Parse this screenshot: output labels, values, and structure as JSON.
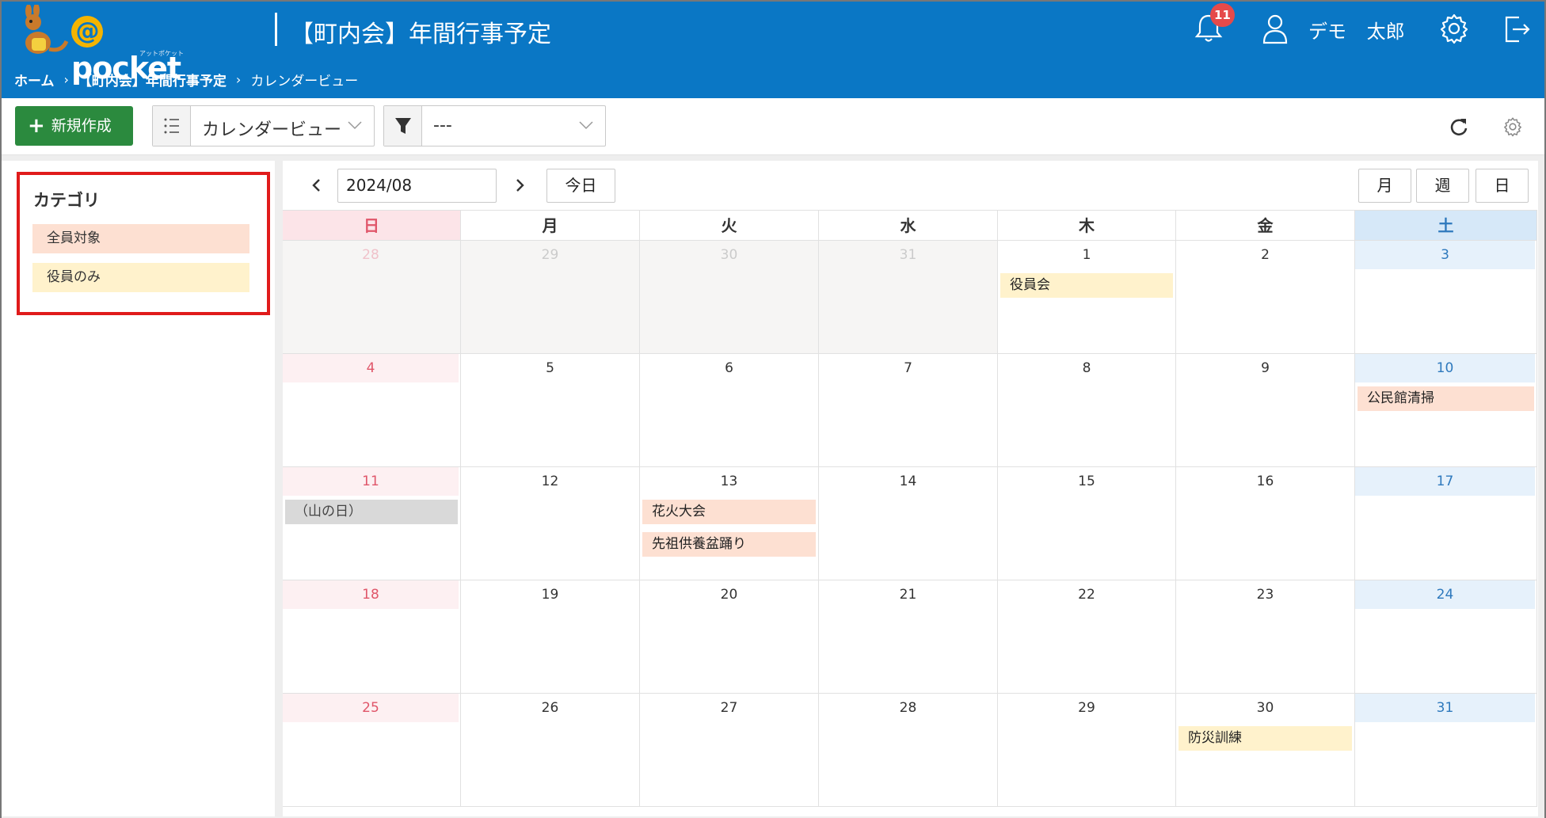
{
  "header": {
    "brand": "pocket",
    "brand_at": "@",
    "brand_sub": "アットポケット",
    "title": "【町内会】年間行事予定",
    "notification_count": "11",
    "user_name": "デモ 太郎",
    "icons": [
      "bell-icon",
      "user-icon",
      "gear-icon",
      "logout-icon"
    ]
  },
  "breadcrumb": {
    "home": "ホーム",
    "app": "【町内会】年間行事予定",
    "current": "カレンダービュー",
    "separator": "›"
  },
  "toolbar": {
    "new_label": "新規作成",
    "view_select": "カレンダービュー",
    "filter_select": "---"
  },
  "sidebar": {
    "category_title": "カテゴリ",
    "categories": [
      {
        "label": "全員対象",
        "color": "#fde0d2"
      },
      {
        "label": "役員のみ",
        "color": "#fff2cc"
      }
    ]
  },
  "calendar": {
    "current_month": "2024/08",
    "today_label": "今日",
    "views": {
      "month": "月",
      "week": "週",
      "day": "日"
    },
    "weekdays": [
      "日",
      "月",
      "火",
      "水",
      "木",
      "金",
      "土"
    ],
    "weeks": [
      [
        {
          "d": "28",
          "other": true
        },
        {
          "d": "29",
          "other": true
        },
        {
          "d": "30",
          "other": true
        },
        {
          "d": "31",
          "other": true
        },
        {
          "d": "1",
          "events": [
            {
              "t": "役員会",
              "k": "officer"
            }
          ]
        },
        {
          "d": "2"
        },
        {
          "d": "3"
        }
      ],
      [
        {
          "d": "4"
        },
        {
          "d": "5"
        },
        {
          "d": "6"
        },
        {
          "d": "7"
        },
        {
          "d": "8"
        },
        {
          "d": "9"
        },
        {
          "d": "10",
          "events": [
            {
              "t": "公民館清掃",
              "k": "all"
            }
          ]
        }
      ],
      [
        {
          "d": "11",
          "events": [
            {
              "t": "（山の日）",
              "k": "holiday"
            }
          ]
        },
        {
          "d": "12"
        },
        {
          "d": "13",
          "events": [
            {
              "t": "花火大会",
              "k": "all"
            },
            {
              "t": "先祖供養盆踊り",
              "k": "all"
            }
          ]
        },
        {
          "d": "14"
        },
        {
          "d": "15"
        },
        {
          "d": "16"
        },
        {
          "d": "17"
        }
      ],
      [
        {
          "d": "18"
        },
        {
          "d": "19"
        },
        {
          "d": "20"
        },
        {
          "d": "21"
        },
        {
          "d": "22"
        },
        {
          "d": "23"
        },
        {
          "d": "24"
        }
      ],
      [
        {
          "d": "25"
        },
        {
          "d": "26"
        },
        {
          "d": "27"
        },
        {
          "d": "28"
        },
        {
          "d": "29"
        },
        {
          "d": "30",
          "events": [
            {
              "t": "防災訓練",
              "k": "officer"
            }
          ]
        },
        {
          "d": "31"
        }
      ]
    ]
  },
  "colors": {
    "header_bg": "#0a77c5",
    "new_button": "#2b8a3e",
    "sunday": "#e0566a",
    "saturday": "#2e79bd",
    "highlight_box": "#e01b1b"
  }
}
